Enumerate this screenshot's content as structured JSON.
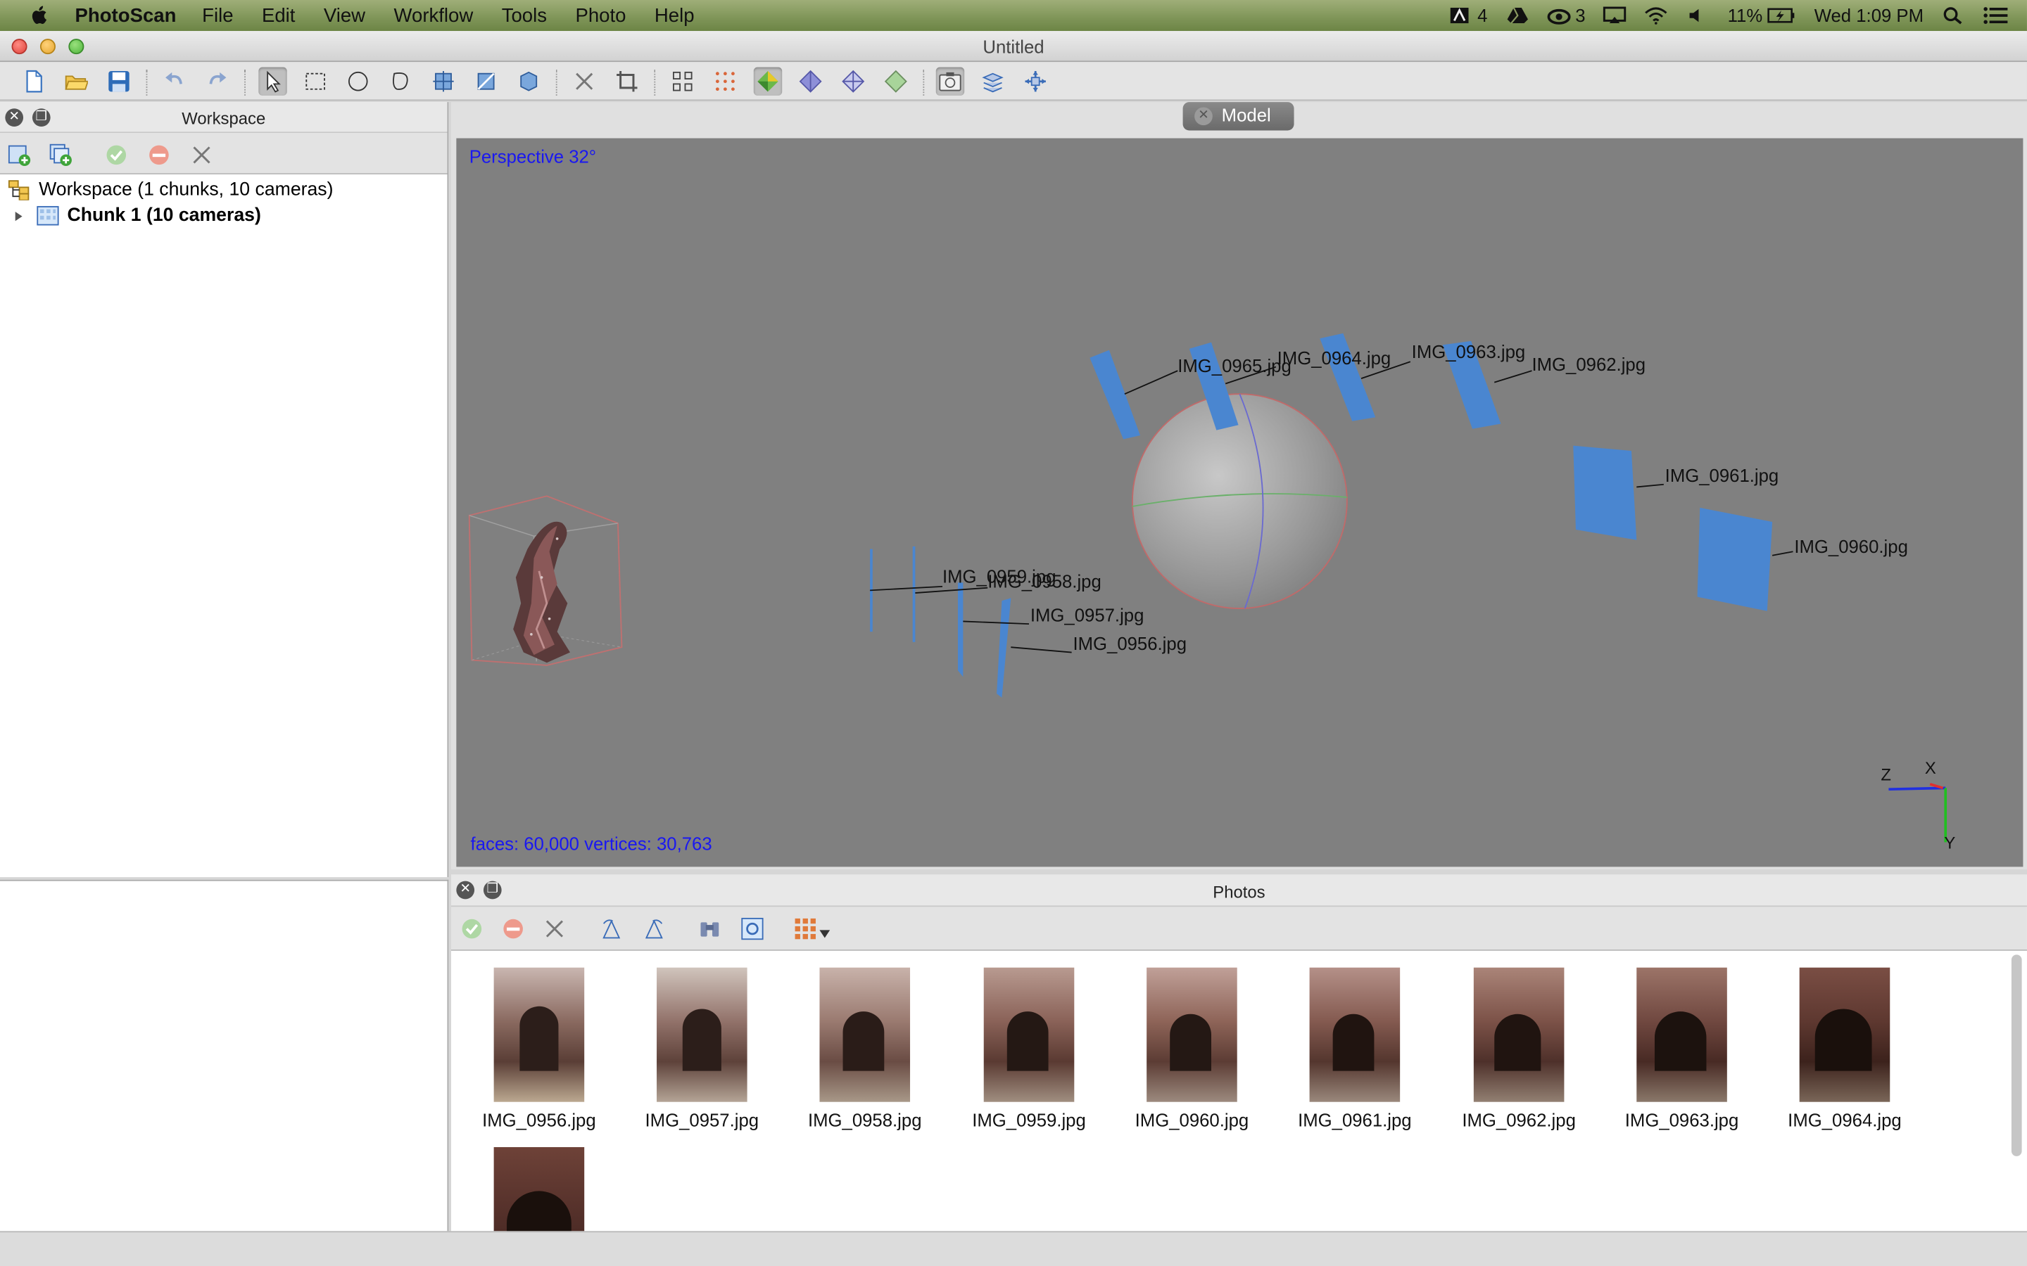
{
  "menubar": {
    "app_name": "PhotoScan",
    "items": [
      "File",
      "Edit",
      "View",
      "Workflow",
      "Tools",
      "Photo",
      "Help"
    ],
    "status": {
      "adobe_count": "4",
      "cc_count": "3",
      "battery": "11%",
      "clock": "Wed 1:09 PM"
    }
  },
  "window": {
    "title": "Untitled"
  },
  "workspace_panel": {
    "title": "Workspace",
    "tree": [
      {
        "label": "Workspace (1 chunks, 10 cameras)"
      },
      {
        "label": "Chunk 1 (10 cameras)"
      }
    ]
  },
  "model_view": {
    "tab_label": "Model",
    "projection": "Perspective 32°",
    "stats": "faces: 60,000 vertices: 30,763",
    "axis_labels": {
      "x": "X",
      "y": "Y",
      "z": "Z"
    },
    "camera_labels": [
      "IMG_0965.jpg",
      "IMG_0964.jpg",
      "IMG_0963.jpg",
      "IMG_0962.jpg",
      "IMG_0961.jpg",
      "IMG_0960.jpg",
      "IMG_0959.jpg",
      "IMG_0958.jpg",
      "IMG_0957.jpg",
      "IMG_0956.jpg"
    ]
  },
  "photos_panel": {
    "title": "Photos",
    "photos": [
      "IMG_0956.jpg",
      "IMG_0957.jpg",
      "IMG_0958.jpg",
      "IMG_0959.jpg",
      "IMG_0960.jpg",
      "IMG_0961.jpg",
      "IMG_0962.jpg",
      "IMG_0963.jpg",
      "IMG_0964.jpg",
      ""
    ]
  },
  "colors": {
    "viewport_bg": "#808080",
    "camera_plane": "#4a86d0",
    "info_text": "#1a18f0"
  }
}
